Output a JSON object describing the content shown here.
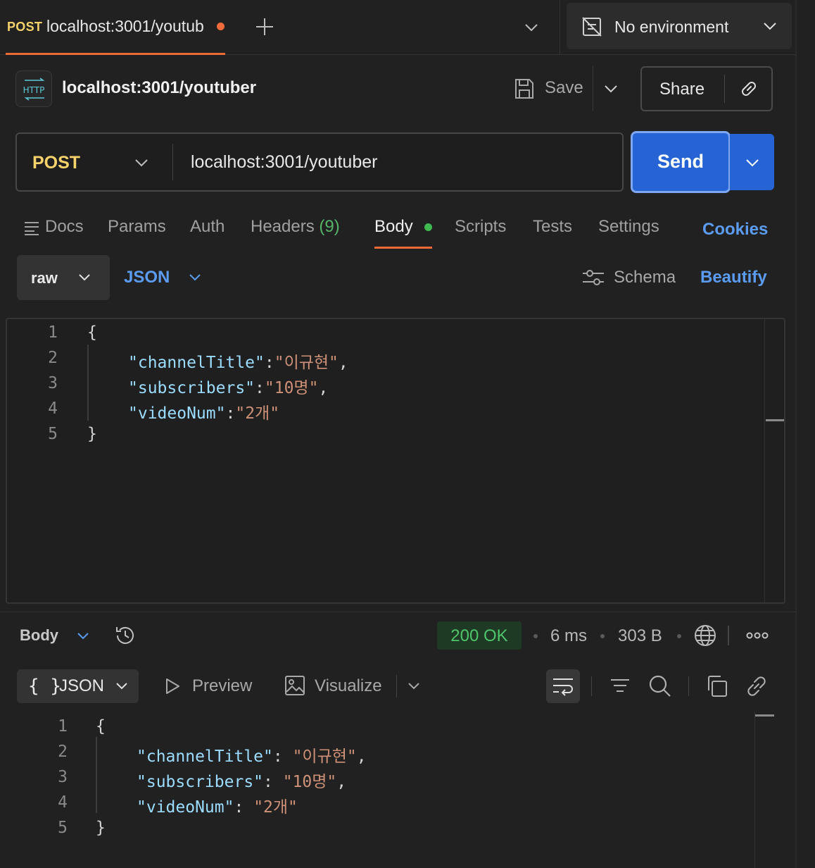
{
  "tab": {
    "method": "POST",
    "title": "localhost:3001/youtub"
  },
  "environment": {
    "label": "No environment"
  },
  "request": {
    "name": "localhost:3001/youtuber",
    "badge": "HTTP",
    "method": "POST",
    "url": "localhost:3001/youtuber"
  },
  "actions": {
    "save": "Save",
    "share": "Share",
    "send": "Send"
  },
  "request_tabs": {
    "docs": "Docs",
    "params": "Params",
    "auth": "Auth",
    "headers": "Headers",
    "headers_count": "(9)",
    "body": "Body",
    "scripts": "Scripts",
    "tests": "Tests",
    "settings": "Settings",
    "cookies": "Cookies"
  },
  "body_toolbar": {
    "mode": "raw",
    "type": "JSON",
    "schema": "Schema",
    "beautify": "Beautify"
  },
  "request_body": {
    "lines": [
      {
        "num": "1",
        "open": "{"
      },
      {
        "num": "2",
        "key": "\"channelTitle\"",
        "sep": ":",
        "value": "\"이규현\"",
        "end": ","
      },
      {
        "num": "3",
        "key": "\"subscribers\"",
        "sep": ":",
        "value": "\"10명\"",
        "end": ","
      },
      {
        "num": "4",
        "key": "\"videoNum\"",
        "sep": ":",
        "value": "\"2개\"",
        "end": ""
      },
      {
        "num": "5",
        "close": "}"
      }
    ]
  },
  "response": {
    "body_label": "Body",
    "status": "200 OK",
    "status_color": "#4fc46a",
    "time": "6 ms",
    "size": "303 B",
    "format": "JSON",
    "format_braces": "{ }",
    "preview": "Preview",
    "visualize": "Visualize",
    "lines": [
      {
        "num": "1",
        "open": "{"
      },
      {
        "num": "2",
        "key": "\"channelTitle\"",
        "sep": ": ",
        "value": "\"이규현\"",
        "end": ","
      },
      {
        "num": "3",
        "key": "\"subscribers\"",
        "sep": ": ",
        "value": "\"10명\"",
        "end": ","
      },
      {
        "num": "4",
        "key": "\"videoNum\"",
        "sep": ": ",
        "value": "\"2개\"",
        "end": ""
      },
      {
        "num": "5",
        "close": "}"
      }
    ]
  },
  "colors": {
    "accent_orange": "#ef6b35",
    "send_blue": "#2664d6",
    "link_blue": "#5b9bf0",
    "method_yellow": "#f6d26b"
  },
  "icons": [
    "plus-icon",
    "chevron-down-icon",
    "no-environment-icon",
    "http-icon",
    "save-icon",
    "link-icon",
    "docs-icon",
    "schema-icon",
    "history-icon",
    "globe-icon",
    "more-icon",
    "preview-icon",
    "visualize-icon",
    "wrap-icon",
    "filter-icon",
    "search-icon",
    "copy-icon"
  ]
}
